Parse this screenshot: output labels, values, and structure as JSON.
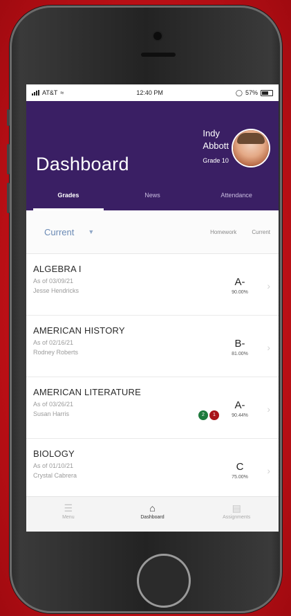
{
  "status_bar": {
    "carrier": "AT&T",
    "time": "12:40 PM",
    "battery": "57%"
  },
  "header": {
    "title": "Dashboard",
    "user_name_line1": "Indy",
    "user_name_line2": "Abbott",
    "user_grade": "Grade 10"
  },
  "tabs": [
    {
      "label": "Grades",
      "active": true
    },
    {
      "label": "News",
      "active": false
    },
    {
      "label": "Attendance",
      "active": false
    }
  ],
  "filter": {
    "selected": "Current",
    "links": [
      "Homework",
      "Current"
    ]
  },
  "courses": [
    {
      "name": "ALGEBRA I",
      "as_of": "As of 03/09/21",
      "teacher": "Jesse Hendricks",
      "grade": "A-",
      "percent": "90.00%"
    },
    {
      "name": "AMERICAN HISTORY",
      "as_of": "As of 02/16/21",
      "teacher": "Rodney Roberts",
      "grade": "B-",
      "percent": "81.00%"
    },
    {
      "name": "AMERICAN LITERATURE",
      "as_of": "As of 03/26/21",
      "teacher": "Susan Harris",
      "grade": "A-",
      "percent": "90.44%",
      "badges": {
        "green": "2",
        "red": "1"
      }
    },
    {
      "name": "BIOLOGY",
      "as_of": "As of 01/10/21",
      "teacher": "Crystal Cabrera",
      "grade": "C",
      "percent": "75.00%"
    }
  ],
  "bottom_nav": [
    {
      "label": "Menu",
      "icon": "menu-icon",
      "active": false
    },
    {
      "label": "Dashboard",
      "icon": "home-icon",
      "active": true
    },
    {
      "label": "Assignments",
      "icon": "assignments-icon",
      "active": false
    }
  ],
  "colors": {
    "background": "#c8161c",
    "header": "#3a1f64",
    "badge_green": "#1f7a3d",
    "badge_red": "#a9131a"
  }
}
